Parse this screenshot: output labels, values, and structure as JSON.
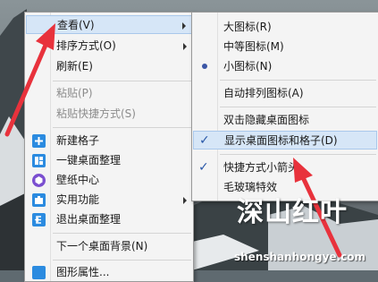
{
  "main_menu": {
    "items": [
      {
        "label": "查看(V)"
      },
      {
        "label": "排序方式(O)"
      },
      {
        "label": "刷新(E)"
      },
      {
        "label": "粘贴(P)"
      },
      {
        "label": "粘贴快捷方式(S)"
      },
      {
        "label": "新建格子"
      },
      {
        "label": "一键桌面整理"
      },
      {
        "label": "壁纸中心"
      },
      {
        "label": "实用功能"
      },
      {
        "label": "退出桌面整理"
      },
      {
        "label": "下一个桌面背景(N)"
      },
      {
        "label": "图形属性..."
      }
    ]
  },
  "sub_menu": {
    "items": [
      {
        "label": "大图标(R)"
      },
      {
        "label": "中等图标(M)"
      },
      {
        "label": "小图标(N)"
      },
      {
        "label": "自动排列图标(A)"
      },
      {
        "label": "双击隐藏桌面图标"
      },
      {
        "label": "显示桌面图标和格子(D)"
      },
      {
        "label": "快捷方式小箭头"
      },
      {
        "label": "毛玻璃特效"
      }
    ]
  },
  "watermark": {
    "text": "深山红叶",
    "url": "shenshanhongye.com"
  },
  "colors": {
    "accent": "#2b8be0",
    "highlight": "#d6e6f7",
    "arrow": "#e8323c"
  }
}
